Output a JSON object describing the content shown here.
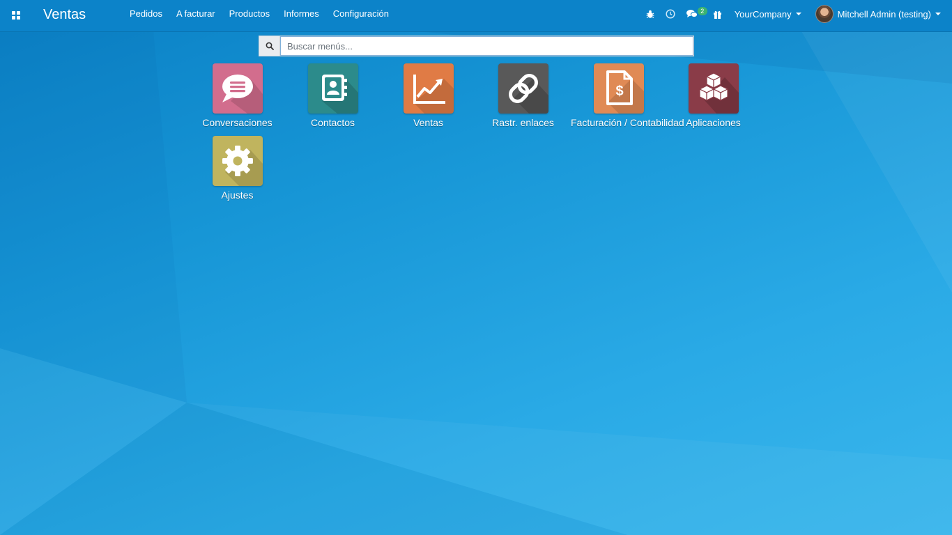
{
  "navbar": {
    "brand": "Ventas",
    "menu": [
      "Pedidos",
      "A facturar",
      "Productos",
      "Informes",
      "Configuración"
    ],
    "messages_badge": "2",
    "company": "YourCompany",
    "user": "Mitchell Admin (testing)"
  },
  "search": {
    "placeholder": "Buscar menús..."
  },
  "apps": [
    {
      "label": "Conversaciones",
      "icon": "chat-bubble-icon",
      "color": "#d26d8d"
    },
    {
      "label": "Contactos",
      "icon": "address-book-icon",
      "color": "#2c8b8b"
    },
    {
      "label": "Ventas",
      "icon": "trend-chart-icon",
      "color": "#e07b45"
    },
    {
      "label": "Rastr. enlaces",
      "icon": "link-icon",
      "color": "#595959"
    },
    {
      "label": "Facturación / Contabilidad",
      "icon": "invoice-dollar-icon",
      "color": "#e08a55"
    },
    {
      "label": "Aplicaciones",
      "icon": "cubes-icon",
      "color": "#8a3c48"
    },
    {
      "label": "Ajustes",
      "icon": "gear-icon",
      "color": "#c0b45e"
    }
  ]
}
